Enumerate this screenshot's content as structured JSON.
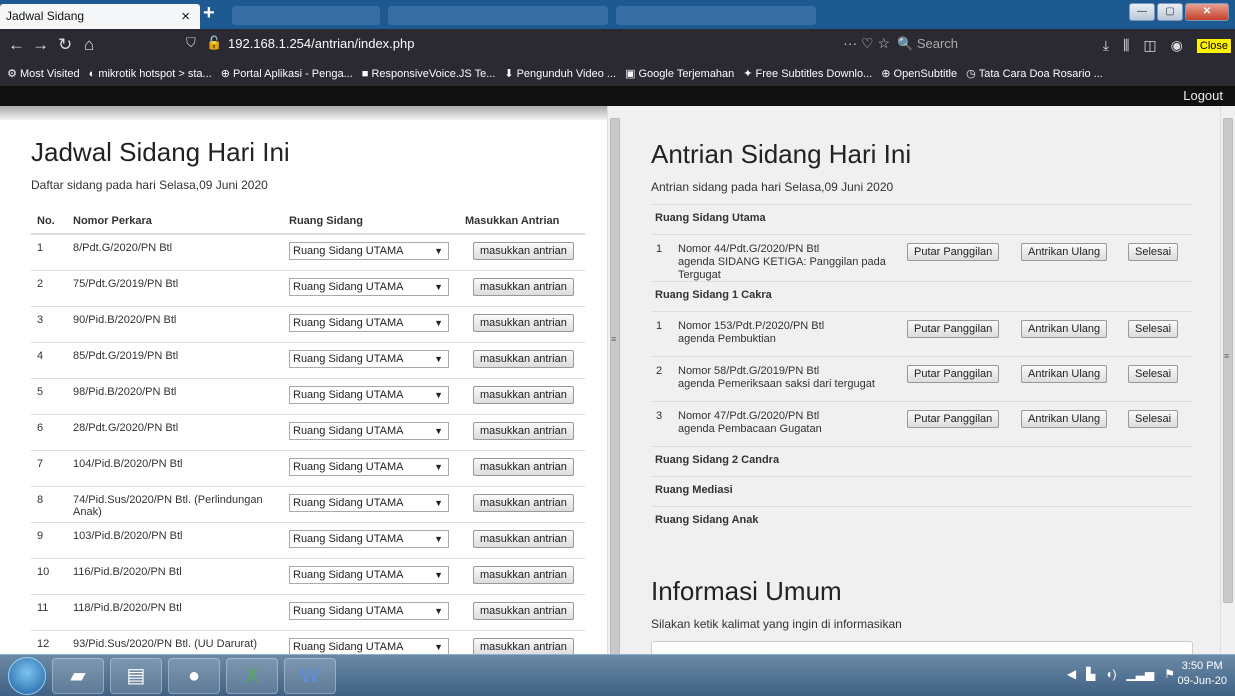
{
  "browser": {
    "tab_title": "Jadwal Sidang",
    "tab_close": "×",
    "new_tab": "+",
    "url": "192.168.1.254/antrian/index.php",
    "url_actions": "··· ♡ ☆",
    "search_placeholder": "Search",
    "close_badge": "Close",
    "bookmarks": [
      {
        "icon": "gear-icon",
        "label": "Most Visited"
      },
      {
        "icon": "mikrotik-icon",
        "label": "mikrotik hotspot > sta..."
      },
      {
        "icon": "globe-icon",
        "label": "Portal Aplikasi - Penga..."
      },
      {
        "icon": "responsivevoice-icon",
        "label": "ResponsiveVoice.JS Te..."
      },
      {
        "icon": "download-icon",
        "label": "Pengunduh Video ..."
      },
      {
        "icon": "google-translate-icon",
        "label": "Google Terjemahan"
      },
      {
        "icon": "subtitles-icon",
        "label": "Free Subtitles Downlo..."
      },
      {
        "icon": "globe-icon",
        "label": "OpenSubtitle"
      },
      {
        "icon": "clock-icon",
        "label": "Tata Cara Doa Rosario ..."
      }
    ]
  },
  "app": {
    "logout": "Logout"
  },
  "jadwal": {
    "title": "Jadwal Sidang Hari Ini",
    "subtitle": "Daftar sidang pada hari Selasa,09 Juni 2020",
    "headers": {
      "no": "No.",
      "nomor": "Nomor Perkara",
      "ruang": "Ruang Sidang",
      "antrian": "Masukkan Antrian"
    },
    "button_label": "masukkan antrian",
    "select_value": "Ruang Sidang UTAMA",
    "rows": [
      {
        "no": "1",
        "nomor": "8/Pdt.G/2020/PN Btl"
      },
      {
        "no": "2",
        "nomor": "75/Pdt.G/2019/PN Btl"
      },
      {
        "no": "3",
        "nomor": "90/Pid.B/2020/PN Btl"
      },
      {
        "no": "4",
        "nomor": "85/Pdt.G/2019/PN Btl"
      },
      {
        "no": "5",
        "nomor": "98/Pid.B/2020/PN Btl"
      },
      {
        "no": "6",
        "nomor": "28/Pdt.G/2020/PN Btl"
      },
      {
        "no": "7",
        "nomor": "104/Pid.B/2020/PN Btl"
      },
      {
        "no": "8",
        "nomor": "74/Pid.Sus/2020/PN Btl. (Perlindungan Anak)"
      },
      {
        "no": "9",
        "nomor": "103/Pid.B/2020/PN Btl"
      },
      {
        "no": "10",
        "nomor": "116/Pid.B/2020/PN Btl"
      },
      {
        "no": "11",
        "nomor": "118/Pid.B/2020/PN Btl"
      },
      {
        "no": "12",
        "nomor": "93/Pid.Sus/2020/PN Btl. (UU Darurat)"
      }
    ]
  },
  "antrian": {
    "title": "Antrian Sidang Hari Ini",
    "subtitle": "Antrian sidang pada hari Selasa,09 Juni 2020",
    "btn_putar": "Putar Panggilan",
    "btn_ulang": "Antrikan Ulang",
    "btn_selesai": "Selesai",
    "rooms": [
      {
        "name": "Ruang Sidang Utama",
        "queue": [
          {
            "no": "1",
            "nomor": "Nomor 44/Pdt.G/2020/PN Btl",
            "agenda": "agenda SIDANG KETIGA: Panggilan pada Tergugat"
          }
        ]
      },
      {
        "name": "Ruang Sidang 1 Cakra",
        "queue": [
          {
            "no": "1",
            "nomor": "Nomor 153/Pdt.P/2020/PN Btl",
            "agenda": "agenda Pembuktian"
          },
          {
            "no": "2",
            "nomor": "Nomor 58/Pdt.G/2019/PN Btl",
            "agenda": "agenda Pemeriksaan saksi dari tergugat"
          },
          {
            "no": "3",
            "nomor": "Nomor 47/Pdt.G/2020/PN Btl",
            "agenda": "agenda Pembacaan Gugatan"
          }
        ]
      },
      {
        "name": "Ruang Sidang 2 Candra",
        "queue": []
      },
      {
        "name": "Ruang Mediasi",
        "queue": []
      },
      {
        "name": "Ruang Sidang Anak",
        "queue": []
      }
    ]
  },
  "info": {
    "title": "Informasi Umum",
    "subtitle": "Silakan ketik kalimat yang ingin di informasikan",
    "text": ""
  },
  "taskbar": {
    "time": "3:50 PM",
    "date": "09-Jun-20",
    "apps": [
      "start-orb-icon",
      "file-explorer-icon",
      "folder-icon",
      "firefox-icon",
      "excel-icon",
      "word-icon"
    ]
  }
}
